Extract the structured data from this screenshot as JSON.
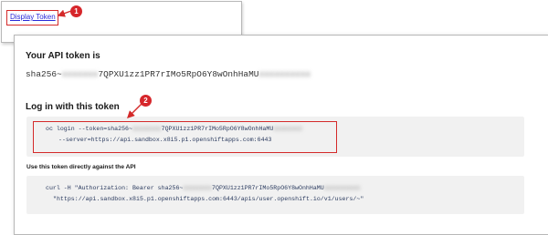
{
  "top_panel": {
    "link_label": "Display Token",
    "badge": "1"
  },
  "token_panel": {
    "title": "Your API token is",
    "token": {
      "prefix": "sha256~",
      "redacted": "xxxxxxx",
      "visible": "7QPXU1zz1PR7rIMo5RpO6Y8wOnhHaMU",
      "redacted_tail": "xxxxxxxxxx"
    },
    "login_heading": "Log in with this token",
    "badge": "2",
    "login_command": {
      "line1_prefix": "oc login --token=sha256~",
      "redacted": "xxxxxxxx",
      "line1_visible": "7QPXU1zz1PR7rIMo5RpO6Y8wOnhHaMU",
      "redacted_tail": "xxxxxxxx",
      "line2": "--server=https://api.sandbox.x8i5.p1.openshiftapps.com:6443"
    },
    "direct_heading": "Use this token directly against the API",
    "curl_command": {
      "line1_prefix": "curl -H \"Authorization: Bearer sha256~",
      "redacted": "xxxxxxxx",
      "line1_visible": "7QPXU1zz1PR7rIMo5RpO6Y8wOnhHaMU",
      "redacted_tail": "xxxxxxxxxx",
      "line2": "\"https://api.sandbox.x8i5.p1.openshiftapps.com:6443/apis/user.openshift.io/v1/users/~\""
    }
  },
  "colors": {
    "annotation_red": "#d42a2a",
    "link_blue": "#2a2ad8",
    "code_bg": "#f1f1f1"
  }
}
